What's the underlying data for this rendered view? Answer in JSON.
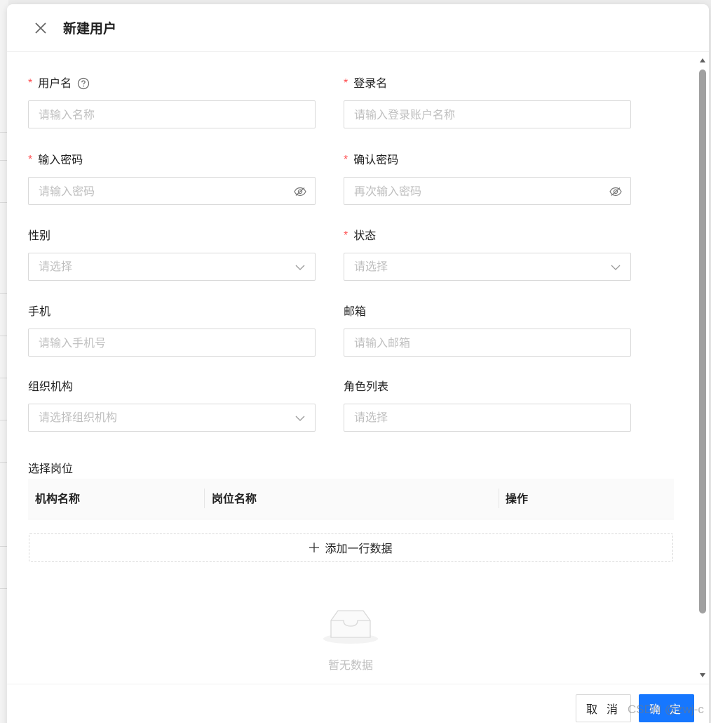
{
  "modal": {
    "title": "新建用户",
    "close_icon": "close-icon"
  },
  "form": {
    "username": {
      "label": "用户名",
      "required": true,
      "placeholder": "请输入名称",
      "help_icon": "question-circle-icon"
    },
    "login_name": {
      "label": "登录名",
      "required": true,
      "placeholder": "请输入登录账户名称"
    },
    "password": {
      "label": "输入密码",
      "required": true,
      "placeholder": "请输入密码",
      "suffix_icon": "eye-invisible-icon"
    },
    "confirm_password": {
      "label": "确认密码",
      "required": true,
      "placeholder": "再次输入密码",
      "suffix_icon": "eye-invisible-icon"
    },
    "gender": {
      "label": "性别",
      "required": false,
      "placeholder": "请选择",
      "suffix_icon": "chevron-down-icon"
    },
    "status": {
      "label": "状态",
      "required": true,
      "placeholder": "请选择",
      "suffix_icon": "chevron-down-icon"
    },
    "phone": {
      "label": "手机",
      "required": false,
      "placeholder": "请输入手机号"
    },
    "email": {
      "label": "邮箱",
      "required": false,
      "placeholder": "请输入邮箱"
    },
    "organization": {
      "label": "组织机构",
      "required": false,
      "placeholder": "请选择组织机构",
      "suffix_icon": "chevron-down-icon"
    },
    "roles": {
      "label": "角色列表",
      "required": false,
      "placeholder": "请选择"
    }
  },
  "positions": {
    "label": "选择岗位",
    "columns": [
      "机构名称",
      "岗位名称",
      "操作"
    ],
    "add_row_label": "添加一行数据",
    "add_row_icon": "plus-icon",
    "empty_text": "暂无数据",
    "empty_icon": "empty-inbox-icon"
  },
  "footer": {
    "cancel_label": "取 消",
    "ok_label": "确 定"
  },
  "watermark": "CSDN @zwj-c",
  "colors": {
    "primary": "#1677ff",
    "required": "#ff4d4f",
    "placeholder": "#bfbfbf",
    "border": "#d9d9d9"
  }
}
